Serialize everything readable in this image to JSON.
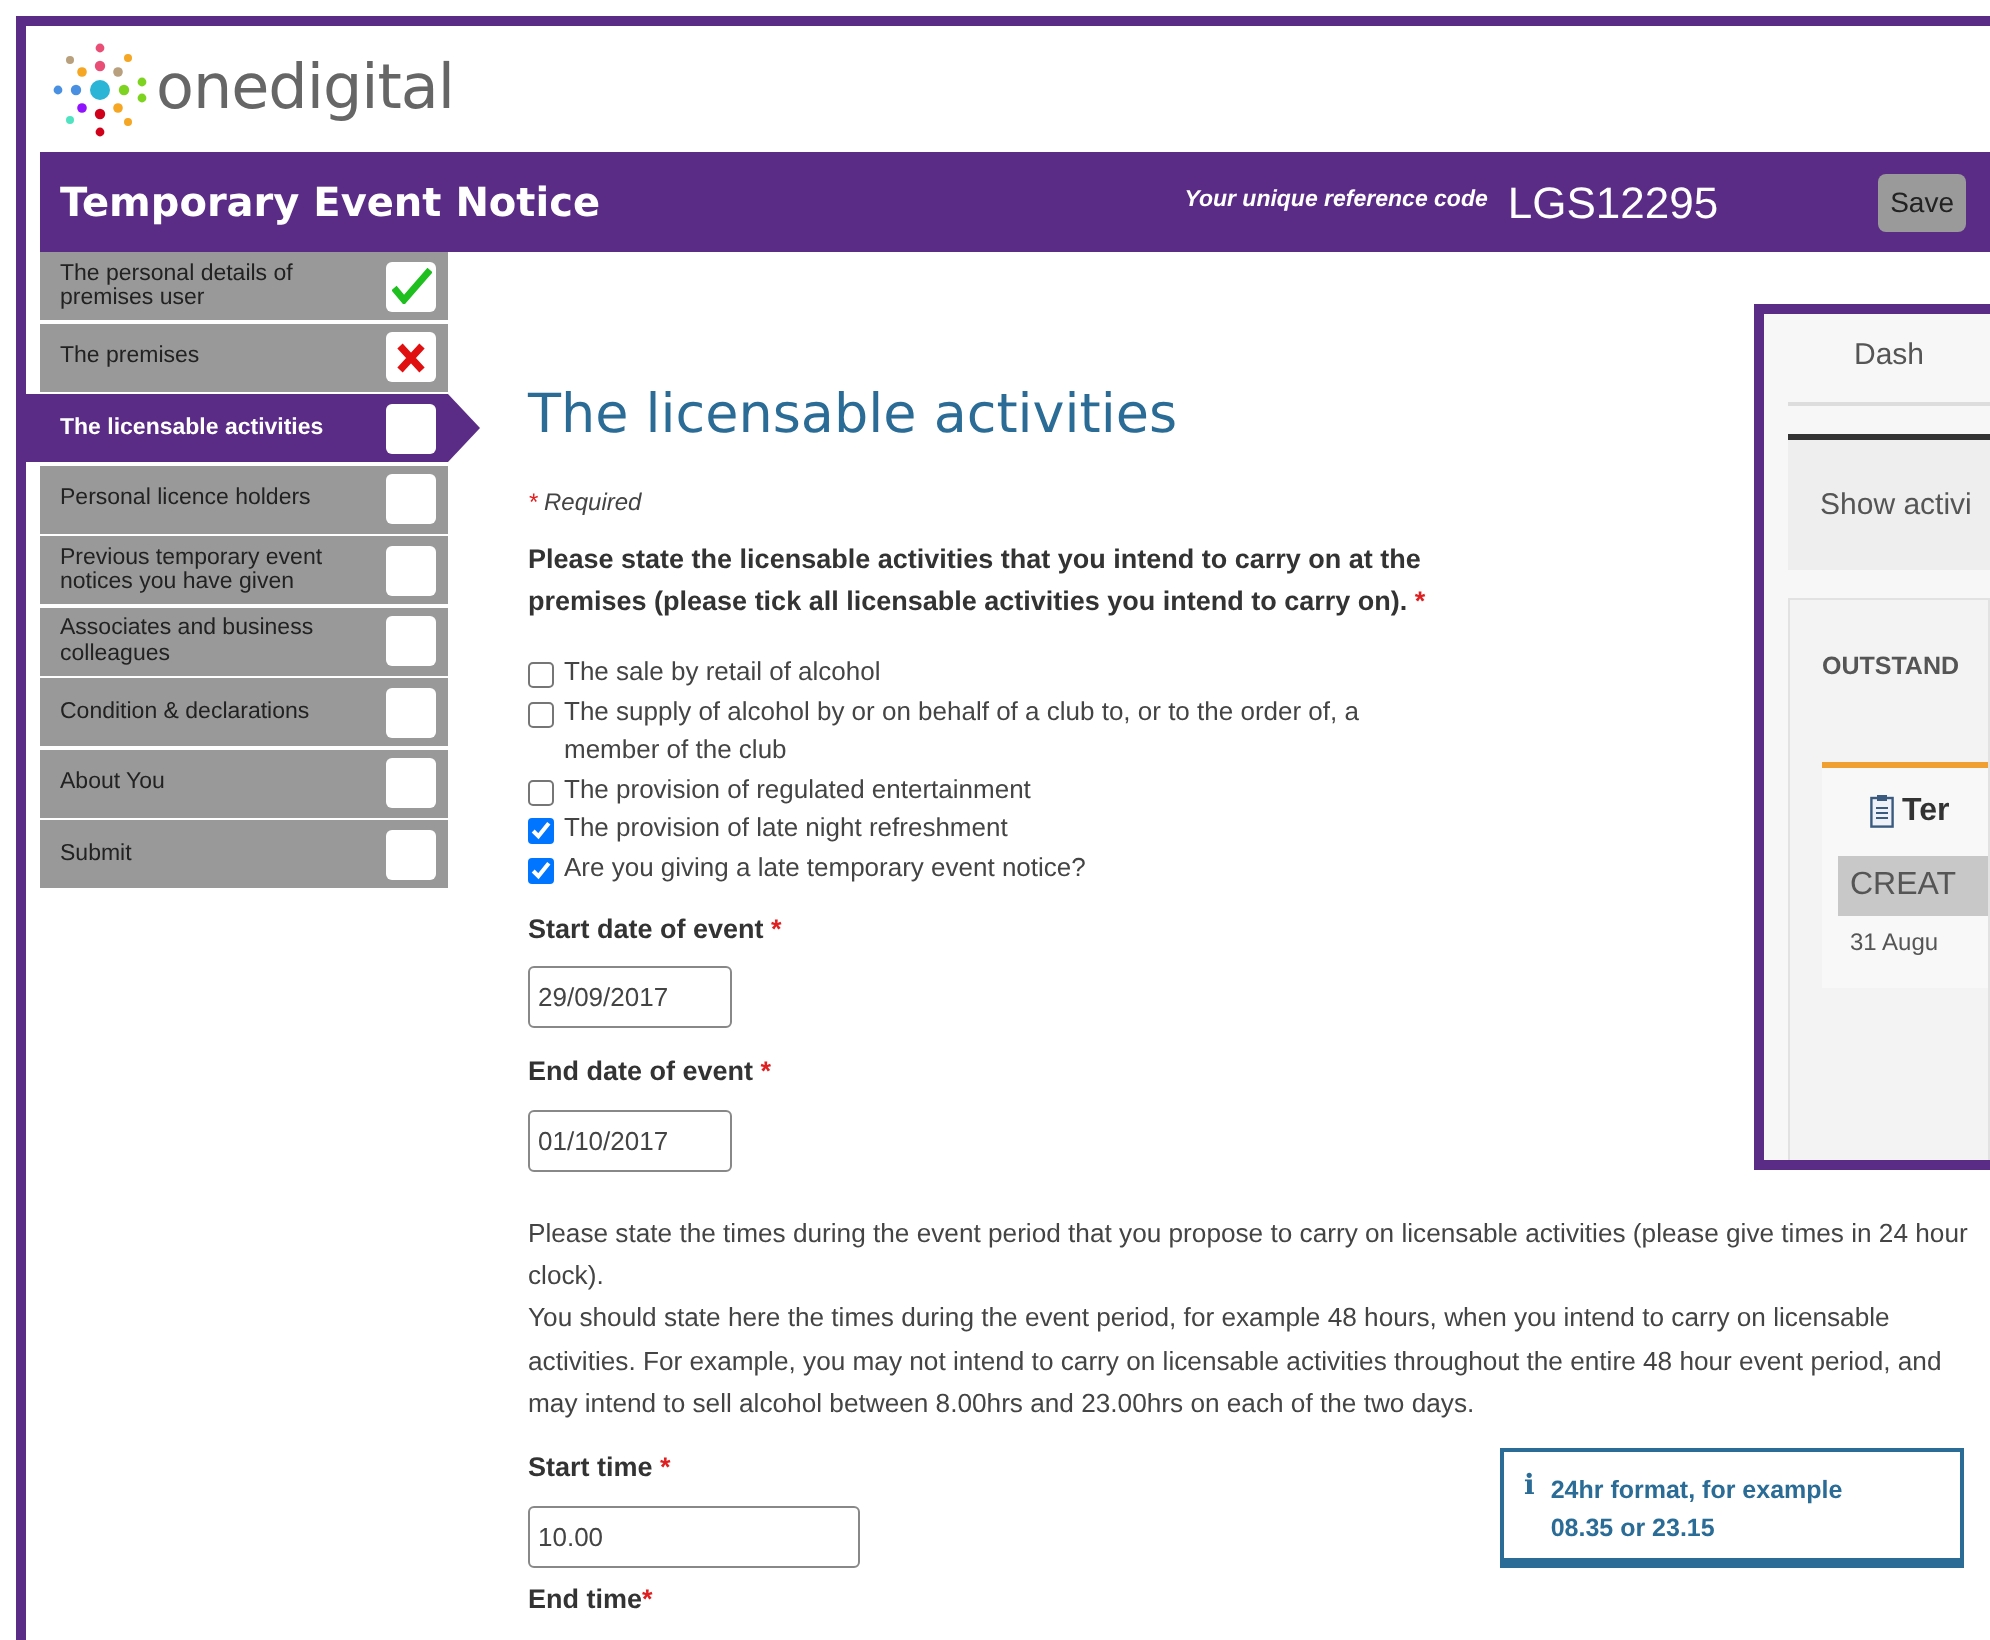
{
  "logo": {
    "text": "onedigital"
  },
  "header": {
    "title": "Temporary Event Notice",
    "reference_label": "Your unique reference code",
    "reference_code": "LGS12295",
    "save_button": "Save"
  },
  "sidebar": {
    "items": [
      {
        "label": "The personal details of premises user",
        "complete": true,
        "error": false,
        "selected": false
      },
      {
        "label": "The premises",
        "complete": false,
        "error": true,
        "selected": false
      },
      {
        "label": "The licensable activities",
        "complete": false,
        "error": false,
        "selected": true
      },
      {
        "label": "Personal licence holders",
        "complete": false,
        "error": false,
        "selected": false
      },
      {
        "label": "Previous temporary event notices you have given",
        "complete": false,
        "error": false,
        "selected": false
      },
      {
        "label": "Associates and business colleagues",
        "complete": false,
        "error": false,
        "selected": false
      },
      {
        "label": "Condition & declarations",
        "complete": false,
        "error": false,
        "selected": false
      },
      {
        "label": "About You",
        "complete": false,
        "error": false,
        "selected": false
      },
      {
        "label": "Submit",
        "complete": false,
        "error": false,
        "selected": false
      }
    ]
  },
  "main": {
    "title": "The licensable activities",
    "required_note": {
      "mark": "*",
      "text": "Required"
    },
    "question": {
      "text": "Please state the licensable activities that you intend to carry on at the premises (please tick all licensable activities you intend to carry on).",
      "mark": "*"
    },
    "activities": [
      {
        "label": "The sale by retail of alcohol",
        "checked": false
      },
      {
        "label": "The supply of alcohol by or on behalf of a club to, or to the order of, a member of the club",
        "checked": false
      },
      {
        "label": "The provision of regulated entertainment",
        "checked": false
      },
      {
        "label": "The provision of late night refreshment",
        "checked": true
      },
      {
        "label": "Are you giving a late temporary event notice?",
        "checked": true
      }
    ],
    "start_date": {
      "label": "Start date of event",
      "mark": "*",
      "value": "29/09/2017"
    },
    "end_date": {
      "label": "End date of event",
      "mark": "*",
      "value": "01/10/2017"
    },
    "times_help": [
      "Please state the times during the event period that you propose to carry on licensable activities (please give times in 24 hour clock).",
      "You should state here the times during the event period, for example 48 hours, when you intend to carry on licensable activities.  For example, you may not intend to carry on licensable activities throughout the entire 48 hour event period, and may intend to sell alcohol between 8.00hrs and 23.00hrs on each of the two days."
    ],
    "start_time": {
      "label": "Start time",
      "mark": "*",
      "value": "10.00"
    },
    "info": {
      "icon": "i",
      "text": "24hr format, for example 08.35 or 23.15"
    },
    "end_time": {
      "label": "End time",
      "mark": "*"
    }
  },
  "inset": {
    "tab": "Dash",
    "filter": "Show activi",
    "heading": "OUTSTAND",
    "item_title": "Ter",
    "status": "CREAT",
    "date": "31 Augu"
  }
}
